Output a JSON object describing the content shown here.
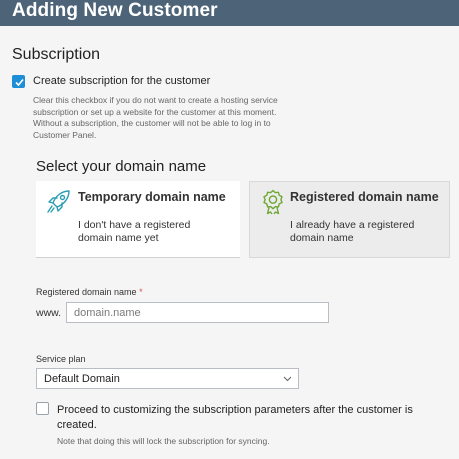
{
  "header": {
    "title": "Adding New Customer"
  },
  "subscription": {
    "section_title": "Subscription",
    "create_checkbox": {
      "label": "Create subscription for the customer",
      "checked": true,
      "hint_lines": [
        "Clear this checkbox if you do not want to create a hosting service",
        "subscription or set up a website for the customer at this moment.",
        "Without a subscription, the customer will not be able to log in to",
        "Customer Panel."
      ]
    }
  },
  "domain": {
    "heading": "Select your domain name",
    "options": [
      {
        "title": "Temporary domain name",
        "desc_lines": [
          "I don't have a registered",
          "domain name yet"
        ],
        "icon": "rocket-icon",
        "selected": false
      },
      {
        "title": "Registered domain name",
        "desc_lines": [
          "I already have a registered",
          "domain name"
        ],
        "icon": "award-badge-icon",
        "selected": true
      }
    ],
    "field_label": "Registered domain name",
    "required_mark": "*",
    "prefix": "www.",
    "placeholder": "domain.name",
    "value": ""
  },
  "service_plan": {
    "label": "Service plan",
    "selected": "Default Domain"
  },
  "proceed": {
    "checked": false,
    "label_lines": [
      "Proceed to customizing the subscription parameters after the customer is",
      "created."
    ],
    "note": "Note that doing this will lock the subscription for syncing."
  },
  "colors": {
    "header_bg": "#4d6478",
    "accent": "#1e8fd6",
    "icon_teal": "#2a9db3",
    "icon_green": "#6ea832",
    "required": "#d9534f"
  }
}
